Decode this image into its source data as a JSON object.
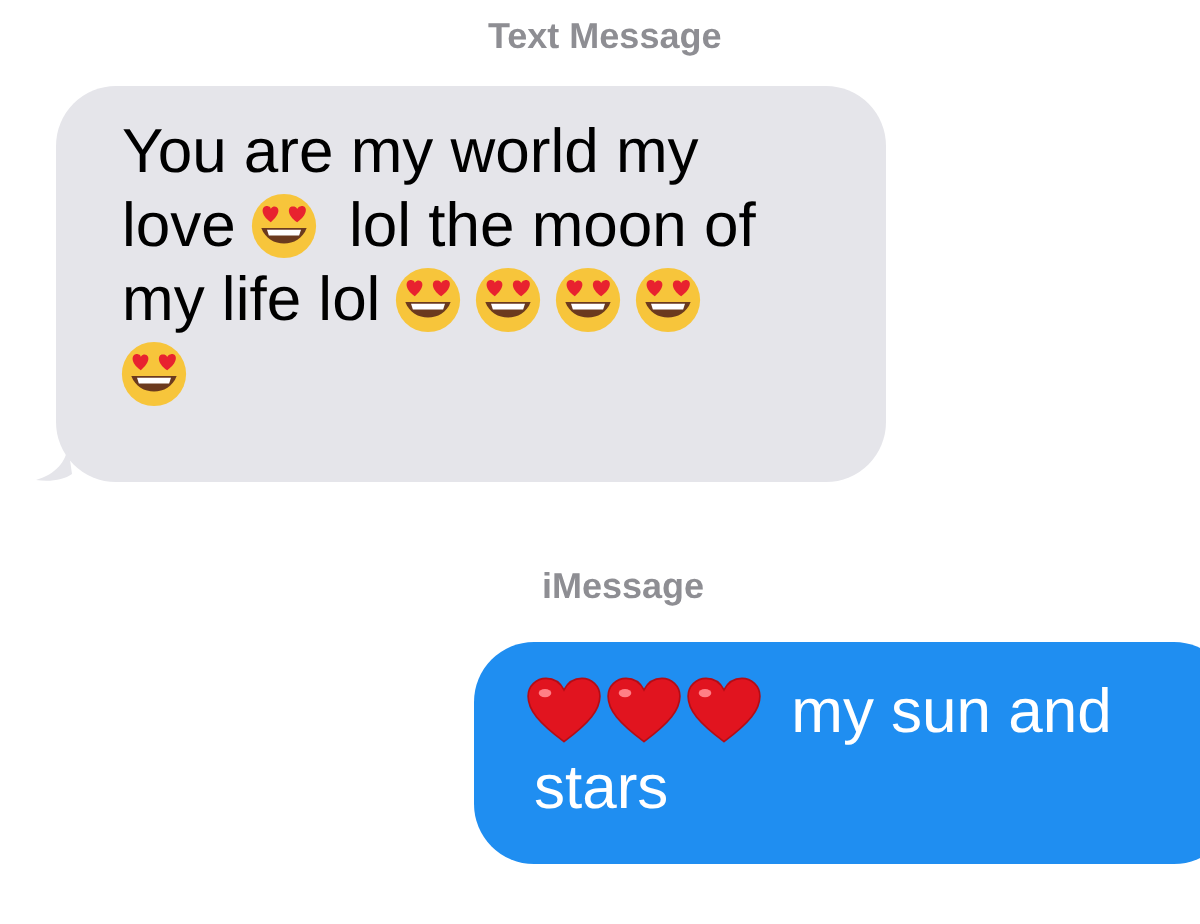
{
  "conversation": [
    {
      "kind": "label",
      "text": "Text Message"
    },
    {
      "kind": "received",
      "parts": [
        {
          "kind": "text",
          "text": "You are my world my"
        },
        {
          "kind": "text",
          "text": "love"
        },
        {
          "kind": "heart-eyes"
        },
        {
          "kind": "text",
          "text": "lol the moon of"
        },
        {
          "kind": "text",
          "text": "my life lol"
        },
        {
          "kind": "heart-eyes"
        },
        {
          "kind": "heart-eyes"
        },
        {
          "kind": "heart-eyes"
        },
        {
          "kind": "heart-eyes"
        },
        {
          "kind": "heart-eyes"
        }
      ]
    },
    {
      "kind": "label",
      "text": "iMessage"
    },
    {
      "kind": "sent",
      "parts": [
        {
          "kind": "heart"
        },
        {
          "kind": "heart"
        },
        {
          "kind": "heart"
        },
        {
          "kind": "text",
          "text": "my sun and"
        },
        {
          "kind": "text",
          "text": "stars"
        }
      ]
    }
  ]
}
